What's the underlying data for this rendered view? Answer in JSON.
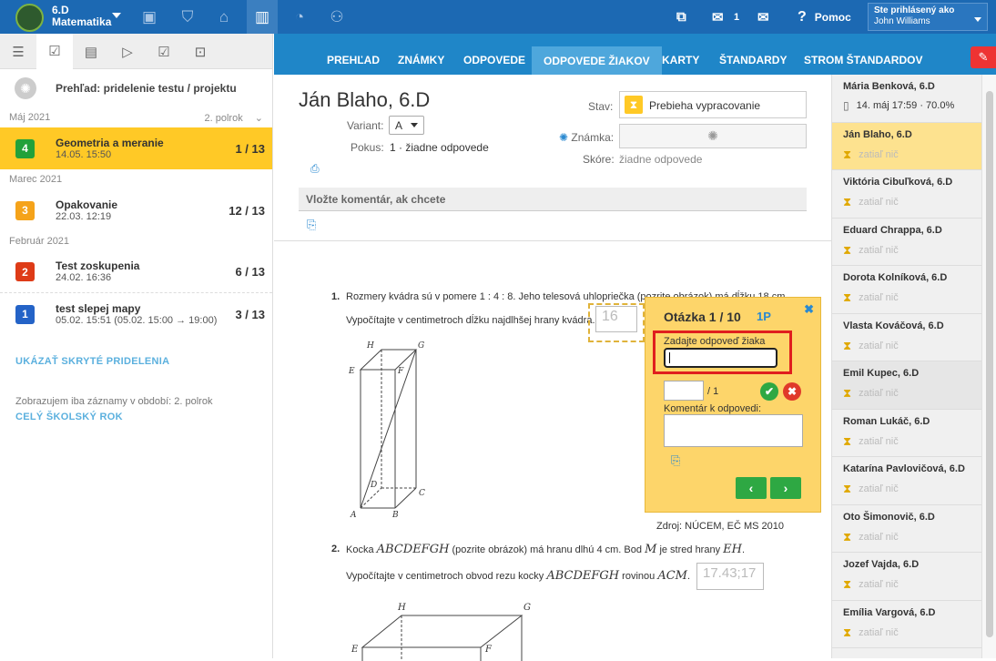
{
  "topbar": {
    "class": "6.D",
    "subject": "Matematika",
    "messages_count": "1",
    "help": "Pomoc",
    "logged_in_label": "Ste prihlásený ako",
    "user": "John Williams"
  },
  "left": {
    "header": "Prehľad: pridelenie testu / projektu",
    "sections": [
      {
        "month": "Máj 2021",
        "term": "2. polrok"
      },
      {
        "month": "Marec 2021"
      },
      {
        "month": "Február 2021"
      }
    ],
    "items": [
      {
        "num": "4",
        "name": "Geometria a meranie",
        "date": "14.05. 15:50",
        "count": "1 / 13",
        "color": "#22a13a"
      },
      {
        "num": "3",
        "name": "Opakovanie",
        "date": "22.03. 12:19",
        "count": "12 / 13",
        "color": "#f5a31a"
      },
      {
        "num": "2",
        "name": "Test zoskupenia",
        "date": "24.02. 16:36",
        "count": "6 / 13",
        "color": "#de3b17"
      },
      {
        "num": "1",
        "name": "test slepej mapy",
        "date": "05.02. 15:51 (05.02. 15:00 → 19:00)",
        "count": "3 / 13",
        "color": "#2463c7"
      }
    ],
    "show_hidden": "UKÁZAŤ SKRYTÉ PRIDELENIA",
    "period_note": "Zobrazujem iba záznamy v období: 2. polrok",
    "whole_year": "CELÝ ŠKOLSKÝ ROK"
  },
  "nav": [
    "PREHĽAD",
    "ZNÁMKY",
    "ODPOVEDE",
    "ODPOVEDE ŽIAKOV",
    "KARTY",
    "ŠTANDARDY",
    "STROM ŠTANDARDOV"
  ],
  "main": {
    "student": "Ján Blaho, 6.D",
    "variant_label": "Variant:",
    "variant": "A",
    "attempt_label": "Pokus:",
    "attempt": "1 · žiadne odpovede",
    "status_label": "Stav:",
    "status": "Prebieha vypracovanie",
    "grade_label": "Známka:",
    "score_label": "Skóre:",
    "score": "žiadne odpovede",
    "comment_placeholder": "Vložte komentár, ak chcete",
    "q1": {
      "num": "1.",
      "text1": "Rozmery kvádra sú v pomere 1 : 4 : 8. Jeho telesová uhlopriečka (pozrite obrázok) má dĺžku 18 cm.",
      "text2": "Vypočítajte v centimetroch dĺžku najdlhšej hrany kvádra.",
      "answer": "16",
      "source": "Zdroj: NÚCEM, EČ MS 2010"
    },
    "q2": {
      "num": "2.",
      "text1a": "Kocka",
      "cube": "ABCDEFGH",
      "text1b": "(pozrite obrázok) má hranu dlhú 4 cm. Bod",
      "m": "M",
      "text1c": "je stred hrany",
      "eh": "EH",
      "text2a": "Vypočítajte v centimetroch obvod rezu kocky",
      "text2b": "rovinou",
      "acm": "ACM",
      "answer": "17.43;17"
    }
  },
  "popup": {
    "title": "Otázka 1 / 10",
    "points": "1P",
    "enter_label": "Zadajte odpoveď žiaka",
    "max": "/ 1",
    "comment_label": "Komentár k odpovedi:"
  },
  "students": [
    {
      "name": "Mária Benková, 6.D",
      "status": "14. máj 17:59 · 70.0%"
    },
    {
      "name": "Ján Blaho, 6.D",
      "status": "zatiaľ nič"
    },
    {
      "name": "Viktória Cibuľková, 6.D",
      "status": "zatiaľ nič"
    },
    {
      "name": "Eduard Chrappa, 6.D",
      "status": "zatiaľ nič"
    },
    {
      "name": "Dorota Kolníková, 6.D",
      "status": "zatiaľ nič"
    },
    {
      "name": "Vlasta Kováčová, 6.D",
      "status": "zatiaľ nič"
    },
    {
      "name": "Emil Kupec, 6.D",
      "status": "zatiaľ nič"
    },
    {
      "name": "Roman Lukáč, 6.D",
      "status": "zatiaľ nič"
    },
    {
      "name": "Katarína Pavlovičová, 6.D",
      "status": "zatiaľ nič"
    },
    {
      "name": "Oto Šimonovič, 6.D",
      "status": "zatiaľ nič"
    },
    {
      "name": "Jozef Vajda, 6.D",
      "status": "zatiaľ nič"
    },
    {
      "name": "Emília Vargová, 6.D",
      "status": "zatiaľ nič"
    }
  ]
}
